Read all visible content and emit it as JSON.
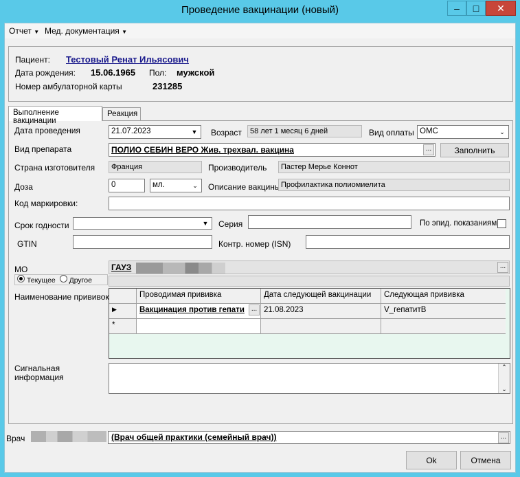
{
  "window": {
    "title": "Проведение вакцинации (новый)",
    "minimize_icon": "minimize-icon",
    "maximize_icon": "maximize-icon",
    "close_icon": "close-icon"
  },
  "menu": {
    "report": "Отчет",
    "med_docs": "Мед. документация"
  },
  "patient": {
    "label": "Пациент:",
    "name": "Тестовый Ренат Ильясович",
    "dob_label": "Дата рождения:",
    "dob": "15.06.1965",
    "sex_label": "Пол:",
    "sex": "мужской",
    "card_label": "Номер амбулаторной карты",
    "card_number": "231285"
  },
  "tabs": [
    "Выполнение вакцинации",
    "Реакция"
  ],
  "form": {
    "date_label": "Дата проведения",
    "date_value": "21.07.2023",
    "age_label": "Возраст",
    "age_value": "58 лет 1 месяц 6 дней",
    "payment_label": "Вид оплаты",
    "payment_value": "ОМС",
    "drug_label": "Вид препарата",
    "drug_value": "ПОЛИО СЕБИН ВЕРО Жив. трехвал. вакцина",
    "fill_button": "Заполнить",
    "country_label": "Страна изготовителя",
    "country_value": "Франция",
    "manufacturer_label": "Производитель",
    "manufacturer_value": "Пастер Мерье Коннот",
    "dose_label": "Доза",
    "dose_value": "0",
    "dose_unit": "мл.",
    "desc_label": "Описание вакцины",
    "desc_value": "Профилактика полиомиелита",
    "marking_label": "Код маркировки:",
    "marking_value": "",
    "expiry_label": "Срок годности",
    "expiry_value": "",
    "series_label": "Серия",
    "series_value": "",
    "epid_label": "По эпид. показаниям",
    "epid_checked": false,
    "gtin_label": "GTIN",
    "gtin_value": "",
    "control_label": "Контр. номер (ISN)",
    "control_value": "",
    "mo_label": "МО",
    "mo_value": "ГАУЗ",
    "mo_radio_current": "Текущее",
    "mo_radio_other": "Другое",
    "vaccinations_label": "Наименование прививок",
    "signal_label_1": "Сигнальная",
    "signal_label_2": "информация",
    "signal_value": ""
  },
  "grid": {
    "headers": [
      "Проводимая прививка",
      "Дата следующей вакцинации",
      "Следующая прививка"
    ],
    "rows": [
      {
        "vaccination": "Вакцинация против гепати",
        "next_date": "21.08.2023",
        "next_vaccination": "V_гепатитВ"
      }
    ],
    "new_row_marker": "*"
  },
  "doctor": {
    "label": "Врач",
    "value": "(Врач общей практики (семейный врач))"
  },
  "buttons": {
    "ok": "Ok",
    "cancel": "Отмена"
  },
  "colors": {
    "titlebar": "#59c9e8",
    "close": "#c7463a",
    "link": "#1a1a8c",
    "grid_bg": "#e8f7ef"
  }
}
